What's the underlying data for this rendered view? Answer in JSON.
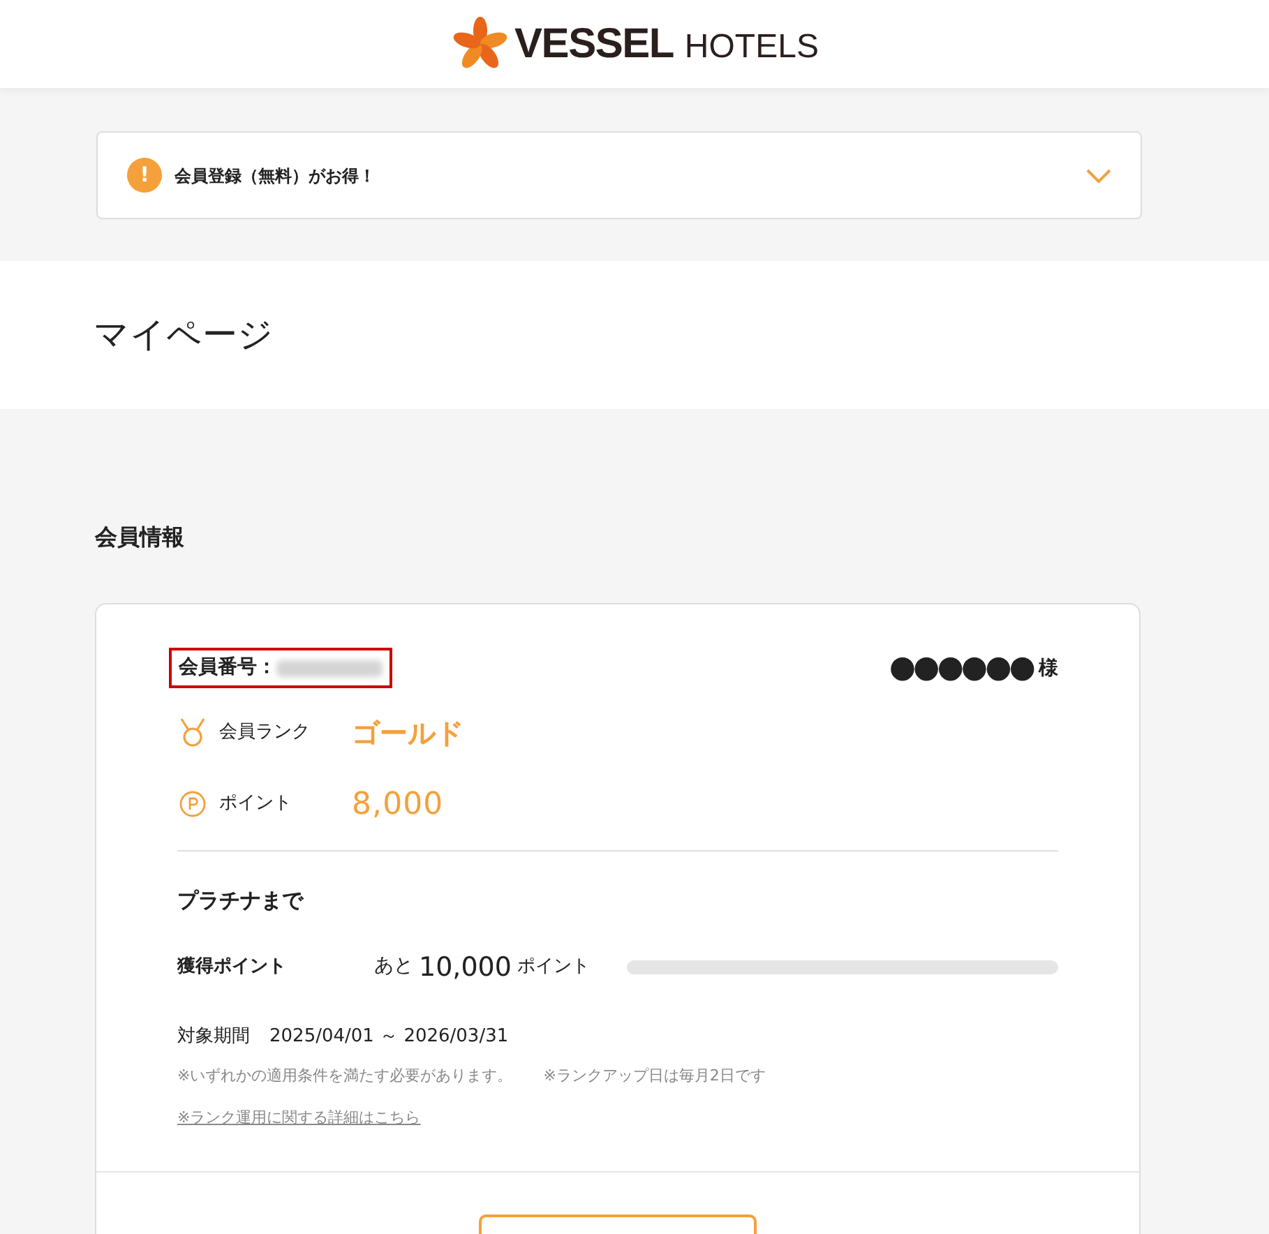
{
  "header": {
    "logo_main": "VESSEL",
    "logo_sub": "HOTELS"
  },
  "notice": {
    "text": "会員登録（無料）がお得！",
    "icon": "!",
    "expanded": false
  },
  "page_title": "マイページ",
  "section_title": "会員情報",
  "member": {
    "number_label": "会員番号：",
    "number_highlighted": true,
    "name": "●●●●●●",
    "honorific": "様",
    "rank_label": "会員ランク",
    "rank": "ゴールド",
    "points_label": "ポイント",
    "points": "8,000"
  },
  "progress": {
    "title": "プラチナまで",
    "label": "獲得ポイント",
    "prefix": "あと",
    "remaining": "10,000",
    "unit": "ポイント",
    "level": 0,
    "period_label": "対象期間",
    "period": "2025/04/01 ～ 2026/03/31",
    "notes": [
      "※いずれかの適用条件を満たす必要があります。",
      "※ランクアップ日は毎月2日です"
    ],
    "link": "※ランク運用に関する詳細はこちら"
  }
}
